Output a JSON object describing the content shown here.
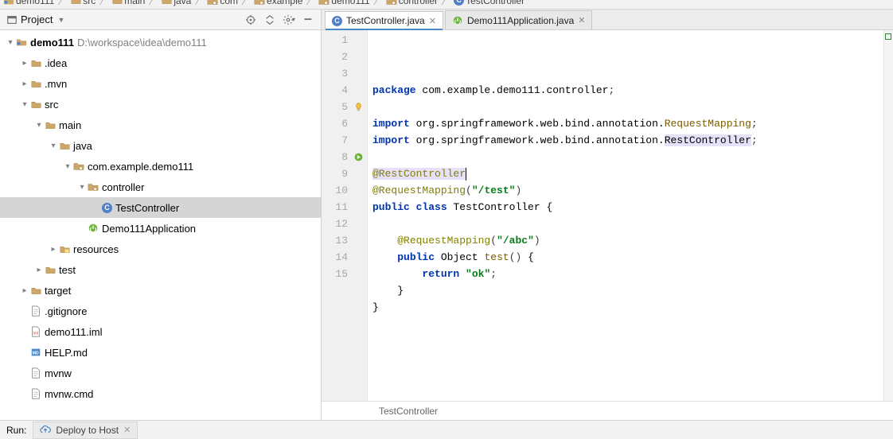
{
  "breadcrumb": {
    "items": [
      {
        "icon": "module",
        "label": "demo111"
      },
      {
        "icon": "dir",
        "label": "src"
      },
      {
        "icon": "dir",
        "label": "main"
      },
      {
        "icon": "dir",
        "label": "java"
      },
      {
        "icon": "pkg",
        "label": "com"
      },
      {
        "icon": "pkg",
        "label": "example"
      },
      {
        "icon": "pkg",
        "label": "demo111"
      },
      {
        "icon": "pkg",
        "label": "controller"
      },
      {
        "icon": "class",
        "label": "TestController"
      }
    ]
  },
  "tool_header": {
    "title": "Project"
  },
  "tree": {
    "root": {
      "label": "demo111",
      "path": "D:\\workspace\\idea\\demo111"
    },
    "nodes": [
      {
        "depth": 1,
        "exp": "closed",
        "icon": "dir",
        "label": ".idea"
      },
      {
        "depth": 1,
        "exp": "closed",
        "icon": "dir",
        "label": ".mvn"
      },
      {
        "depth": 1,
        "exp": "open",
        "icon": "dir",
        "label": "src"
      },
      {
        "depth": 2,
        "exp": "open",
        "icon": "dir",
        "label": "main"
      },
      {
        "depth": 3,
        "exp": "open",
        "icon": "dir",
        "label": "java"
      },
      {
        "depth": 4,
        "exp": "open",
        "icon": "pkg",
        "label": "com.example.demo111"
      },
      {
        "depth": 5,
        "exp": "open",
        "icon": "pkg",
        "label": "controller"
      },
      {
        "depth": 6,
        "exp": "none",
        "icon": "class",
        "label": "TestController",
        "selected": true
      },
      {
        "depth": 5,
        "exp": "none",
        "icon": "spring",
        "label": "Demo111Application"
      },
      {
        "depth": 3,
        "exp": "closed",
        "icon": "res",
        "label": "resources"
      },
      {
        "depth": 2,
        "exp": "closed",
        "icon": "dir",
        "label": "test"
      },
      {
        "depth": 1,
        "exp": "closed",
        "icon": "dir",
        "label": "target"
      },
      {
        "depth": 1,
        "exp": "none",
        "icon": "file",
        "label": ".gitignore"
      },
      {
        "depth": 1,
        "exp": "none",
        "icon": "xml",
        "label": "demo111.iml"
      },
      {
        "depth": 1,
        "exp": "none",
        "icon": "md",
        "label": "HELP.md"
      },
      {
        "depth": 1,
        "exp": "none",
        "icon": "file",
        "label": "mvnw"
      },
      {
        "depth": 1,
        "exp": "none",
        "icon": "file",
        "label": "mvnw.cmd"
      }
    ]
  },
  "tabs": [
    {
      "icon": "class",
      "label": "TestController.java",
      "active": true
    },
    {
      "icon": "spring",
      "label": "Demo111Application.java",
      "active": false
    }
  ],
  "code": {
    "lines": [
      {
        "n": 1,
        "tokens": [
          {
            "t": "kw",
            "v": "package"
          },
          {
            "t": "sp",
            "v": " "
          },
          {
            "t": "imp-name",
            "v": "com.example.demo111.controller"
          },
          {
            "t": "ident",
            "v": ";"
          }
        ]
      },
      {
        "n": 2,
        "tokens": []
      },
      {
        "n": 3,
        "tokens": [
          {
            "t": "kw",
            "v": "import"
          },
          {
            "t": "sp",
            "v": " "
          },
          {
            "t": "imp-name",
            "v": "org.springframework.web.bind.annotation."
          },
          {
            "t": "fn",
            "v": "RequestMapping"
          },
          {
            "t": "ident",
            "v": ";"
          }
        ]
      },
      {
        "n": 4,
        "tokens": [
          {
            "t": "kw",
            "v": "import"
          },
          {
            "t": "sp",
            "v": " "
          },
          {
            "t": "imp-name",
            "v": "org.springframework.web.bind.annotation."
          },
          {
            "t": "imp-hi",
            "v": "RestController"
          },
          {
            "t": "ident",
            "v": ";"
          }
        ]
      },
      {
        "n": 5,
        "tokens": [],
        "bulb": true
      },
      {
        "n": 6,
        "tokens": [
          {
            "t": "ann-hi",
            "v": "@RestController"
          }
        ],
        "highlight": true,
        "caret": true
      },
      {
        "n": 7,
        "tokens": [
          {
            "t": "ann",
            "v": "@RequestMapping"
          },
          {
            "t": "ident",
            "v": "("
          },
          {
            "t": "str",
            "v": "\"/test\""
          },
          {
            "t": "ident",
            "v": ")"
          }
        ]
      },
      {
        "n": 8,
        "tokens": [
          {
            "t": "kw",
            "v": "public class"
          },
          {
            "t": "sp",
            "v": " "
          },
          {
            "t": "cls",
            "v": "TestController"
          },
          {
            "t": "sp",
            "v": " "
          },
          {
            "t": "brace",
            "v": "{"
          }
        ],
        "runmark": true
      },
      {
        "n": 9,
        "tokens": []
      },
      {
        "n": 10,
        "tokens": [
          {
            "t": "indent",
            "v": "    "
          },
          {
            "t": "ann",
            "v": "@RequestMapping"
          },
          {
            "t": "ident",
            "v": "("
          },
          {
            "t": "str",
            "v": "\"/abc\""
          },
          {
            "t": "ident",
            "v": ")"
          }
        ]
      },
      {
        "n": 11,
        "tokens": [
          {
            "t": "indent",
            "v": "    "
          },
          {
            "t": "kw",
            "v": "public"
          },
          {
            "t": "sp",
            "v": " "
          },
          {
            "t": "cls",
            "v": "Object"
          },
          {
            "t": "sp",
            "v": " "
          },
          {
            "t": "fn",
            "v": "test"
          },
          {
            "t": "ident",
            "v": "() "
          },
          {
            "t": "brace",
            "v": "{"
          }
        ]
      },
      {
        "n": 12,
        "tokens": [
          {
            "t": "indent",
            "v": "        "
          },
          {
            "t": "kw",
            "v": "return"
          },
          {
            "t": "sp",
            "v": " "
          },
          {
            "t": "str",
            "v": "\"ok\""
          },
          {
            "t": "ident",
            "v": ";"
          }
        ]
      },
      {
        "n": 13,
        "tokens": [
          {
            "t": "indent",
            "v": "    "
          },
          {
            "t": "brace",
            "v": "}"
          }
        ]
      },
      {
        "n": 14,
        "tokens": [
          {
            "t": "brace",
            "v": "}"
          }
        ]
      },
      {
        "n": 15,
        "tokens": []
      }
    ]
  },
  "editor_crumb": "TestController",
  "bottom": {
    "run": "Run:",
    "tab": "Deploy to Host"
  }
}
